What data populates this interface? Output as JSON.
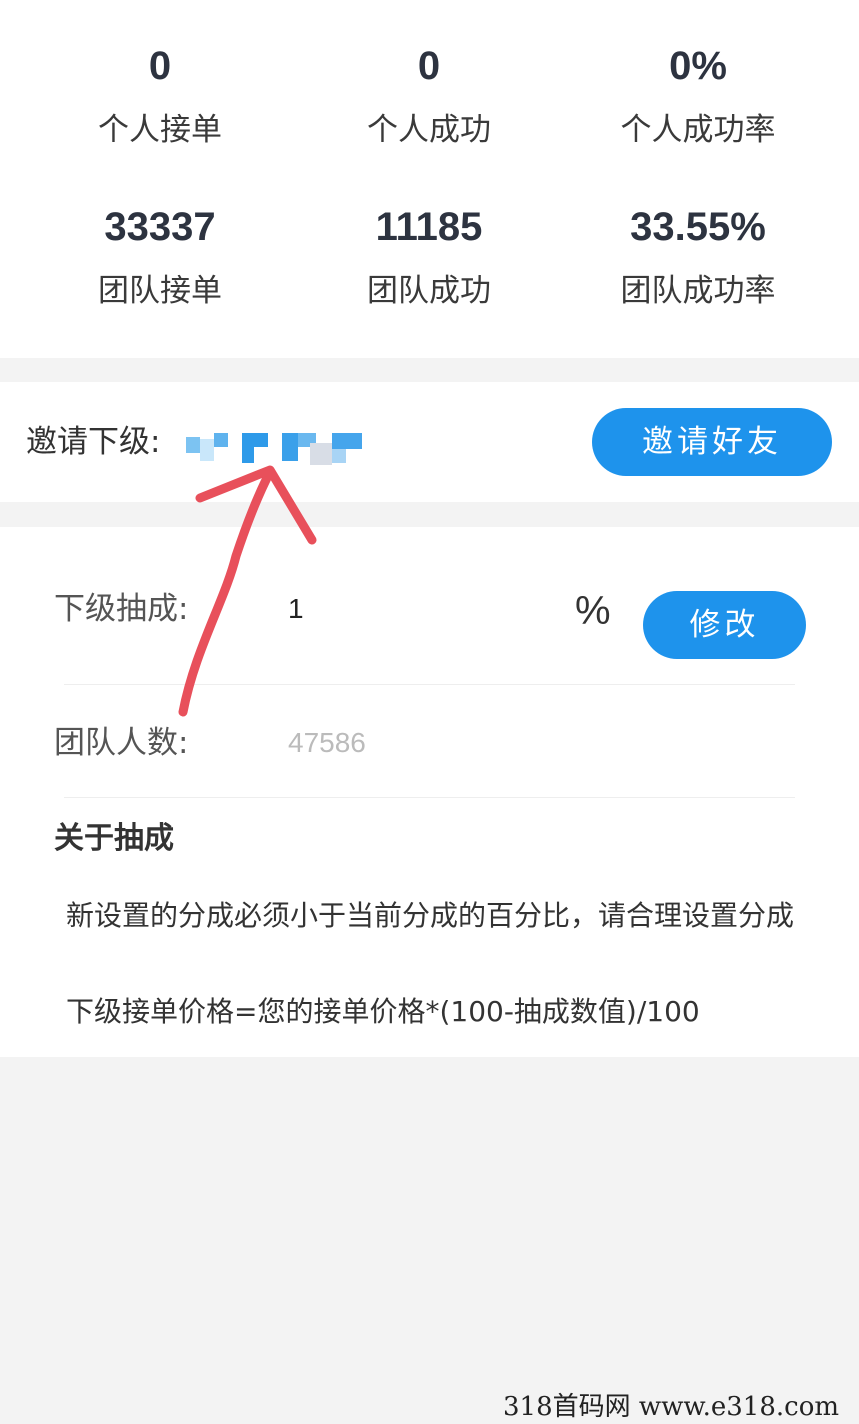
{
  "personal": {
    "orders": {
      "value": "0",
      "label": "个人接单"
    },
    "success": {
      "value": "0",
      "label": "个人成功"
    },
    "rate": {
      "value": "0%",
      "label": "个人成功率"
    }
  },
  "team": {
    "orders": {
      "value": "33337",
      "label": "团队接单"
    },
    "success": {
      "value": "11185",
      "label": "团队成功"
    },
    "rate": {
      "value": "33.55%",
      "label": "团队成功率"
    }
  },
  "invite": {
    "label": "邀请下级:",
    "button": "邀请好友"
  },
  "commission": {
    "label": "下级抽成:",
    "value": "1",
    "unit": "%",
    "button": "修改"
  },
  "team_size": {
    "label": "团队人数:",
    "value": "47586"
  },
  "about": {
    "title": "关于抽成",
    "line1": "新设置的分成必须小于当前分成的百分比，请合理设置分成",
    "line2": "下级接单价格=您的接单价格*(100-抽成数值)/100"
  },
  "watermark": "318首码网 www.e318.com",
  "colors": {
    "accent": "#1e93ec",
    "annotation_arrow": "#e8505b"
  }
}
